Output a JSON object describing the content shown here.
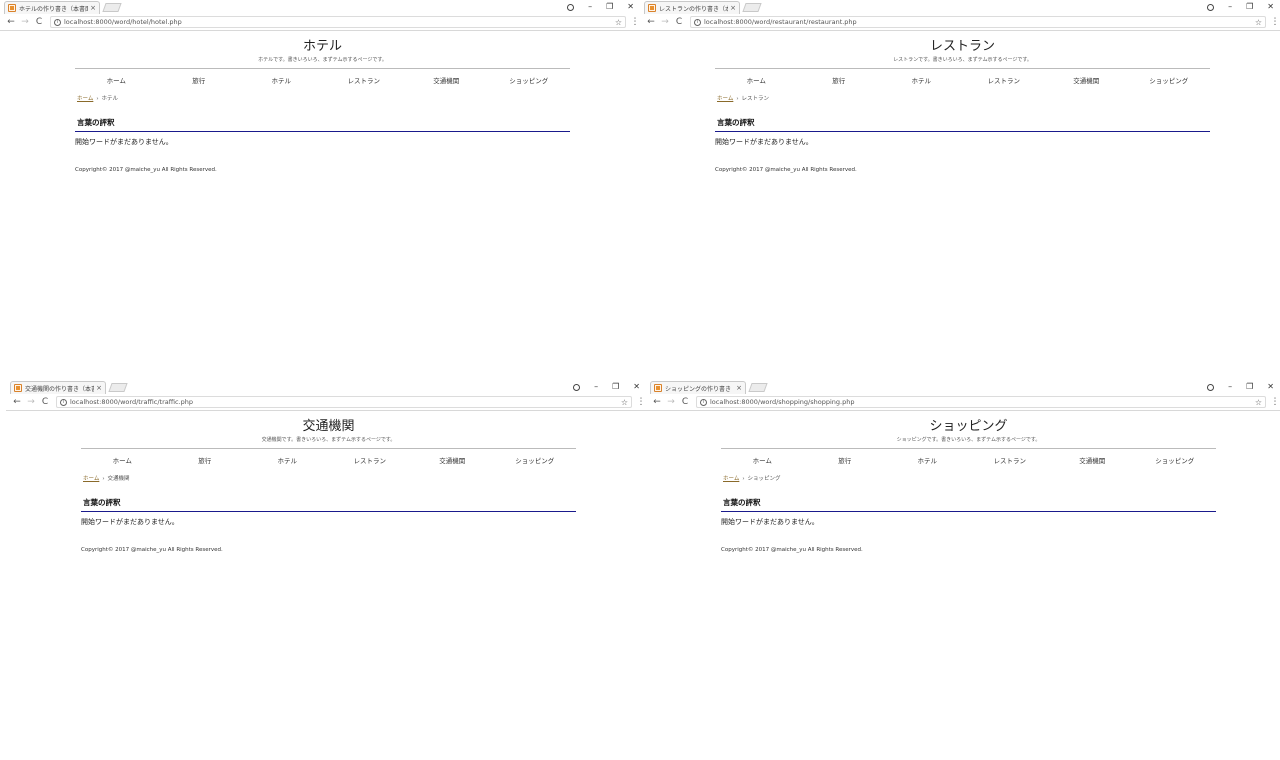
{
  "windows": [
    {
      "tab_title": "ホテルの作り書き（本書面",
      "url": "localhost:8000/word/hotel/hotel.php",
      "page": {
        "title": "ホテル",
        "description": "ホテルです。書きいろいろ、まずテム示するページです。",
        "nav": [
          "ホーム",
          "旅行",
          "ホテル",
          "レストラン",
          "交通機関",
          "ショッピング"
        ],
        "breadcrumb_home": "ホーム",
        "breadcrumb_current": "ホテル",
        "section_heading": "言葉の評釈",
        "section_body": "開始ワードがまだありません。",
        "copyright": "Copyright© 2017 @maiche_yu All Rights Reserved."
      }
    },
    {
      "tab_title": "レストランの作り書き（本書面",
      "url": "localhost:8000/word/restaurant/restaurant.php",
      "page": {
        "title": "レストラン",
        "description": "レストランです。書きいろいろ、まずテム示するページです。",
        "nav": [
          "ホーム",
          "旅行",
          "ホテル",
          "レストラン",
          "交通機関",
          "ショッピング"
        ],
        "breadcrumb_home": "ホーム",
        "breadcrumb_current": "レストラン",
        "section_heading": "言葉の評釈",
        "section_body": "開始ワードがまだありません。",
        "copyright": "Copyright© 2017 @maiche_yu All Rights Reserved."
      }
    },
    {
      "tab_title": "交通機関の作り書き（本書面",
      "url": "localhost:8000/word/traffic/traffic.php",
      "page": {
        "title": "交通機関",
        "description": "交通機関です。書きいろいろ、まずテム示するページです。",
        "nav": [
          "ホーム",
          "旅行",
          "ホテル",
          "レストラン",
          "交通機関",
          "ショッピング"
        ],
        "breadcrumb_home": "ホーム",
        "breadcrumb_current": "交通機関",
        "section_heading": "言葉の評釈",
        "section_body": "開始ワードがまだありません。",
        "copyright": "Copyright© 2017 @maiche_yu All Rights Reserved."
      }
    },
    {
      "tab_title": "ショッピングの作り書き（本書面",
      "url": "localhost:8000/word/shopping/shopping.php",
      "page": {
        "title": "ショッピング",
        "description": "ショッピングです。書きいろいろ、まずテム示するページです。",
        "nav": [
          "ホーム",
          "旅行",
          "ホテル",
          "レストラン",
          "交通機関",
          "ショッピング"
        ],
        "breadcrumb_home": "ホーム",
        "breadcrumb_current": "ショッピング",
        "section_heading": "言葉の評釈",
        "section_body": "開始ワードがまだありません。",
        "copyright": "Copyright© 2017 @maiche_yu All Rights Reserved."
      }
    }
  ],
  "chrome": {
    "back_glyph": "←",
    "forward_glyph": "→",
    "reload_glyph": "C",
    "star_glyph": "☆",
    "menu_glyph": "⋮",
    "close_glyph": "✕",
    "minimize_glyph": "–",
    "maximize_glyph": "❐",
    "tab_close_glyph": "×",
    "breadcrumb_separator": "›"
  },
  "colors": {
    "heading_underline": "#1a1a8c",
    "favicon": "#e8902f",
    "breadcrumb_link": "#8a6a2a"
  }
}
